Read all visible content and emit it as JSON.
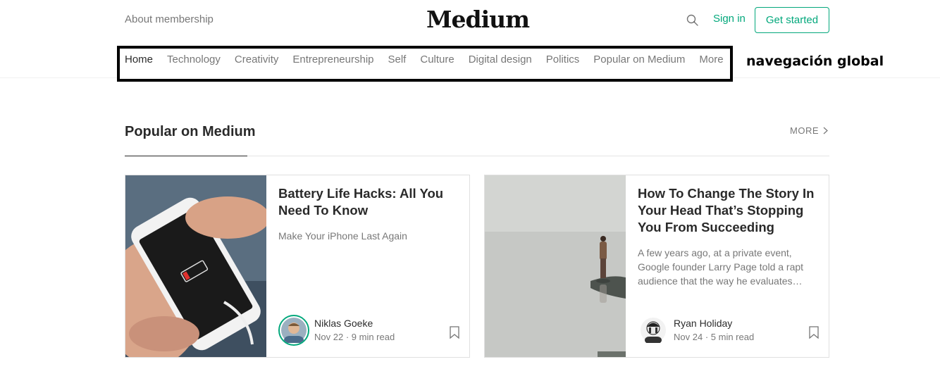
{
  "header": {
    "about_label": "About membership",
    "logo_text": "Medium",
    "search_icon": "search-icon",
    "signin_label": "Sign in",
    "get_started_label": "Get started",
    "accent_color": "#03a87c"
  },
  "nav": {
    "items": [
      {
        "label": "Home",
        "active": true
      },
      {
        "label": "Technology"
      },
      {
        "label": "Creativity"
      },
      {
        "label": "Entrepreneurship"
      },
      {
        "label": "Self"
      },
      {
        "label": "Culture"
      },
      {
        "label": "Digital design"
      },
      {
        "label": "Politics"
      },
      {
        "label": "Popular on Medium"
      },
      {
        "label": "More"
      }
    ],
    "annotation": "navegación global"
  },
  "section": {
    "title": "Popular on Medium",
    "more_label": "MORE"
  },
  "cards": [
    {
      "title": "Battery Life Hacks: All You Need To Know",
      "subtitle": "Make Your iPhone Last Again",
      "author": "Niklas Goeke",
      "date": "Nov 22",
      "read_time": "9 min read"
    },
    {
      "title": "How To Change The Story In Your Head That’s Stopping You From Succeeding",
      "subtitle": "A few years ago, at a private event, Google founder Larry Page told a rapt audience that the way he evaluates…",
      "author": "Ryan Holiday",
      "date": "Nov 24",
      "read_time": "5 min read"
    }
  ]
}
